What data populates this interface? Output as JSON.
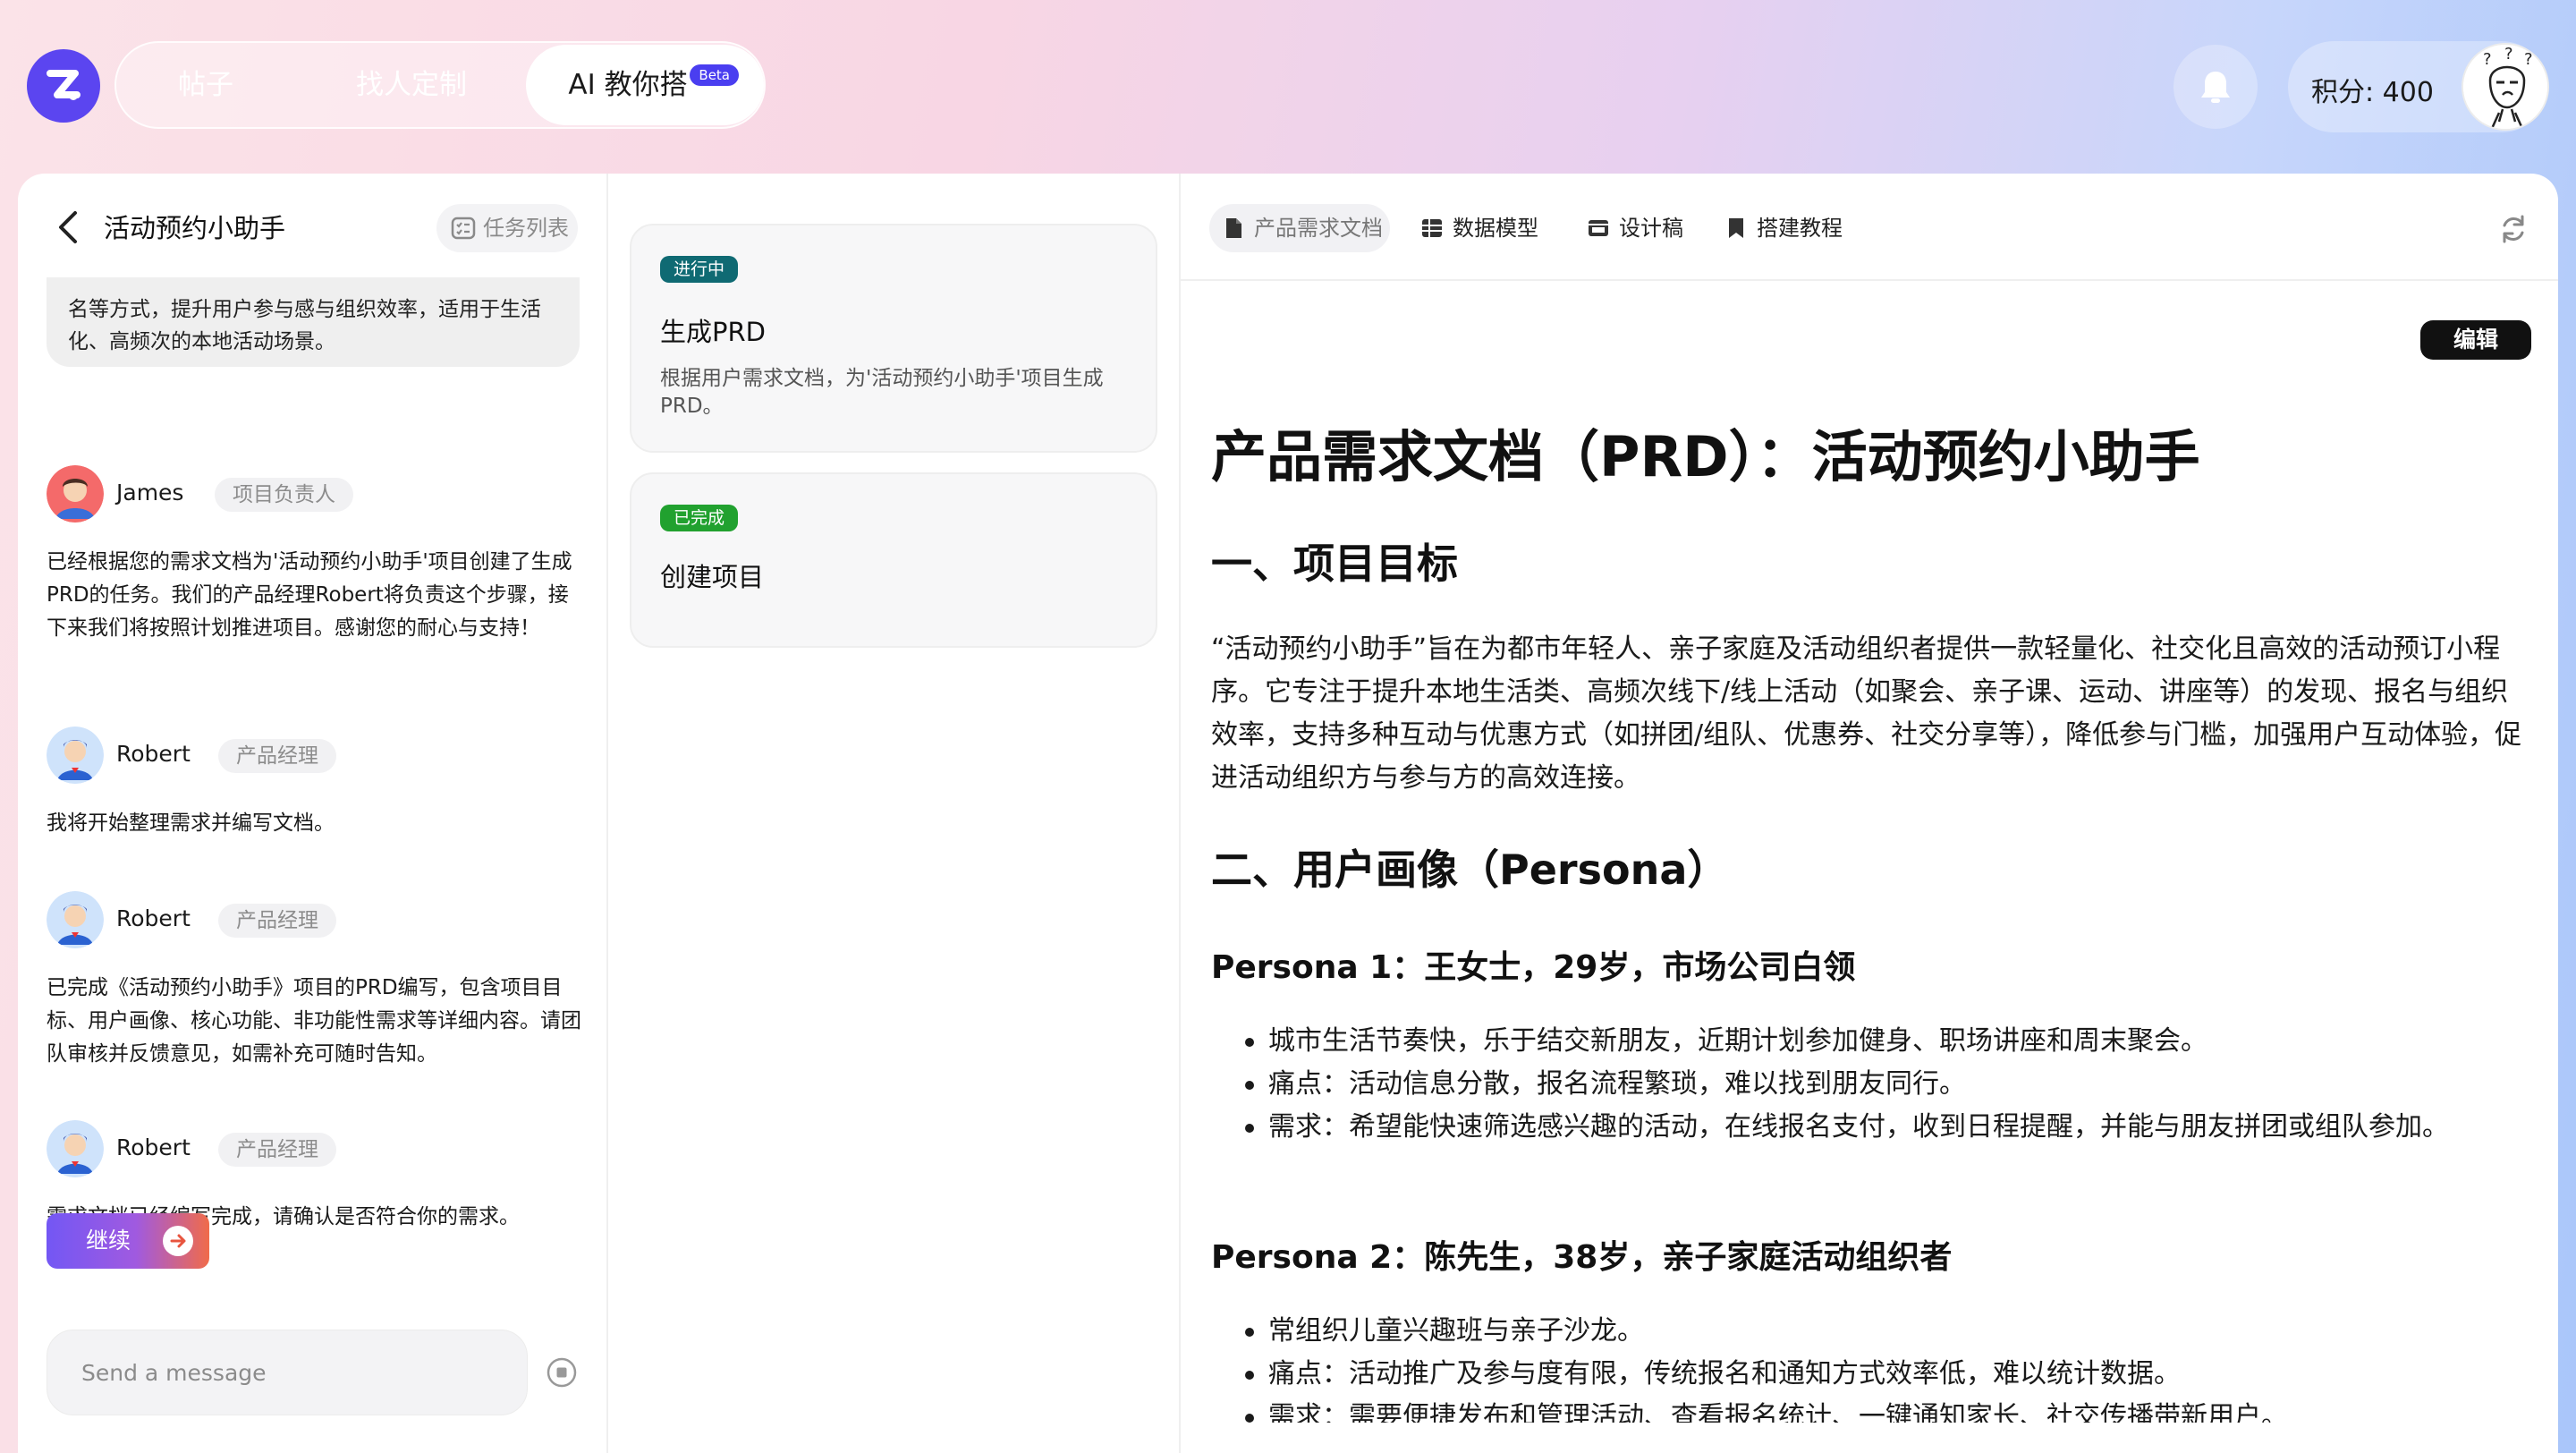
{
  "nav": {
    "tabs": [
      {
        "label": "帖子",
        "active": false
      },
      {
        "label": "找人定制",
        "active": false
      },
      {
        "label": "AI 教你搭",
        "active": true,
        "badge": "Beta"
      }
    ]
  },
  "header": {
    "points_label": "积分: 400"
  },
  "chat": {
    "title": "活动预约小助手",
    "task_list_label": "任务列表",
    "top_bubble_lines": "名等方式，提升用户参与感与组织效率，适用于生活化、高频次的本地活动场景。",
    "messages": [
      {
        "name": "James",
        "role": "项目负责人",
        "text": "已经根据您的需求文档为'活动预约小助手'项目创建了生成PRD的任务。我们的产品经理Robert将负责这个步骤，接下来我们将按照计划推进项目。感谢您的耐心与支持！"
      },
      {
        "name": "Robert",
        "role": "产品经理",
        "text": "我将开始整理需求并编写文档。"
      },
      {
        "name": "Robert",
        "role": "产品经理",
        "text": "已完成《活动预约小助手》项目的PRD编写，包含项目目标、用户画像、核心功能、非功能性需求等详细内容。请团队审核并反馈意见，如需补充可随时告知。"
      },
      {
        "name": "Robert",
        "role": "产品经理",
        "text": "需求文档已经编写完成，请确认是否符合你的需求。"
      }
    ],
    "continue_label": "继续",
    "input_placeholder": "Send a message"
  },
  "tasks": [
    {
      "status": "进行中",
      "title": "生成PRD",
      "desc": "根据用户需求文档，为'活动预约小助手'项目生成PRD。"
    },
    {
      "status": "已完成",
      "title": "创建项目",
      "desc": ""
    }
  ],
  "doc_tabs": [
    {
      "label": "产品需求文档",
      "active": true
    },
    {
      "label": "数据模型",
      "active": false
    },
    {
      "label": "设计稿",
      "active": false
    },
    {
      "label": "搭建教程",
      "active": false
    }
  ],
  "doc": {
    "edit_label": "编辑",
    "title": "产品需求文档（PRD）：活动预约小助手",
    "section1": "一、项目目标",
    "section1_text": "“活动预约小助手”旨在为都市年轻人、亲子家庭及活动组织者提供一款轻量化、社交化且高效的活动预订小程序。它专注于提升本地生活类、高频次线下/线上活动（如聚会、亲子课、运动、讲座等）的发现、报名与组织效率，支持多种互动与优惠方式（如拼团/组队、优惠券、社交分享等），降低参与门槛，加强用户互动体验，促进活动组织方与参与方的高效连接。",
    "section2": "二、用户画像（Persona）",
    "persona1": "Persona 1：王女士，29岁，市场公司白领",
    "persona1_items": [
      "城市生活节奏快，乐于结交新朋友，近期计划参加健身、职场讲座和周末聚会。",
      "痛点：活动信息分散，报名流程繁琐，难以找到朋友同行。",
      "需求：希望能快速筛选感兴趣的活动，在线报名支付，收到日程提醒，并能与朋友拼团或组队参加。"
    ],
    "persona2": "Persona 2：陈先生，38岁，亲子家庭活动组织者",
    "persona2_items": [
      "常组织儿童兴趣班与亲子沙龙。",
      "痛点：活动推广及参与度有限，传统报名和通知方式效率低，难以统计数据。",
      "需求：需要便捷发布和管理活动、查看报名统计、一键通知家长、社交传播带新用户。"
    ]
  }
}
